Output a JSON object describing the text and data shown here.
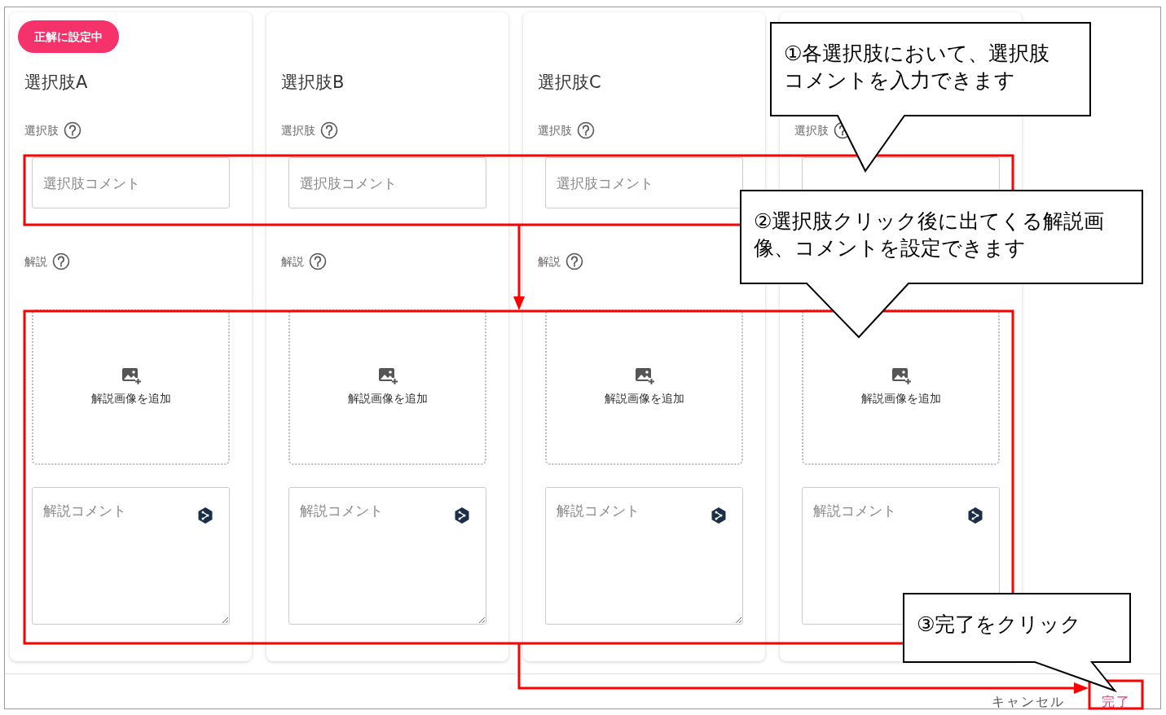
{
  "cards": [
    {
      "badge": "正解に設定中",
      "title": "選択肢A",
      "choice_label": "選択肢",
      "choice_placeholder": "選択肢コメント",
      "explanation_label": "解説",
      "image_label": "解説画像を追加",
      "comment_placeholder": "解説コメント"
    },
    {
      "title": "選択肢B",
      "choice_label": "選択肢",
      "choice_placeholder": "選択肢コメント",
      "explanation_label": "解説",
      "image_label": "解説画像を追加",
      "comment_placeholder": "解説コメント"
    },
    {
      "title": "選択肢C",
      "choice_label": "選択肢",
      "choice_placeholder": "選択肢コメント",
      "explanation_label": "解説",
      "image_label": "解説画像を追加",
      "comment_placeholder": "解説コメント"
    },
    {
      "choice_label": "選択肢",
      "image_label": "解説画像を追加",
      "comment_placeholder": "解説コメント"
    }
  ],
  "footer": {
    "buttons": [
      {
        "label": "キャンセル",
        "kind": "secondary"
      },
      {
        "label": "完了",
        "kind": "primary"
      }
    ]
  },
  "callouts": [
    {
      "text": "①各選択肢において、選択肢コメントを入力できます"
    },
    {
      "text": "②選択肢クリック後に出てくる解説画像、コメントを設定できます"
    },
    {
      "text": "③完了をクリック"
    }
  ]
}
